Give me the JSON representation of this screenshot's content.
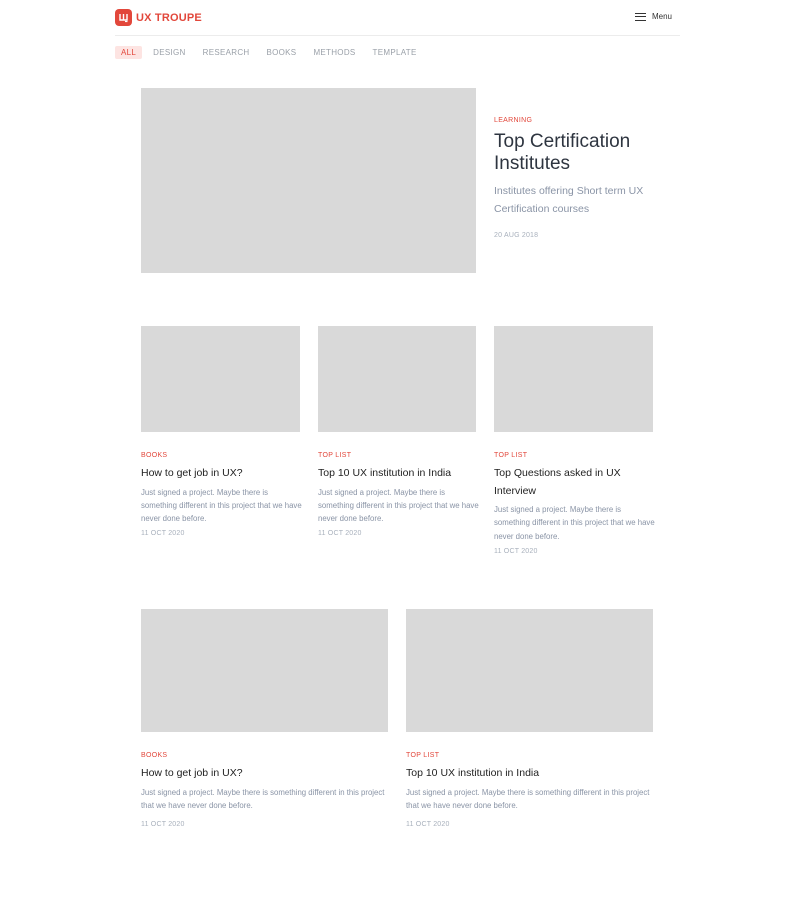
{
  "brand": {
    "name": "UX TROUPE",
    "color": "#e2473b"
  },
  "header": {
    "menu_label": "Menu",
    "menu_icon": "hamburger-icon"
  },
  "filters": [
    {
      "label": "ALL",
      "active": true
    },
    {
      "label": "DESIGN",
      "active": false
    },
    {
      "label": "RESEARCH",
      "active": false
    },
    {
      "label": "BOOKS",
      "active": false
    },
    {
      "label": "METHODS",
      "active": false
    },
    {
      "label": "TEMPLATE",
      "active": false
    }
  ],
  "featured": {
    "category": "LEARNING",
    "title": "Top Certification Institutes",
    "subtitle": "Institutes offering Short term UX Certification courses",
    "date": "20 AUG 2018"
  },
  "row1": [
    {
      "category": "BOOKS",
      "title": "How to get job in UX?",
      "description": "Just signed a project. Maybe there is something different in this project that we have never done before.",
      "date": "11 OCT 2020"
    },
    {
      "category": "TOP LIST",
      "title": "Top 10 UX institution in  India",
      "description": "Just signed a project. Maybe there is something different in this project that we have never done before.",
      "date": "11 OCT 2020"
    },
    {
      "category": "TOP LIST",
      "title": "Top Questions asked in UX Interview",
      "description": "Just signed a project. Maybe there is something different in this project that we have never done before.",
      "date": "11 OCT 2020"
    }
  ],
  "row2": [
    {
      "category": "BOOKS",
      "title": "How to get job in UX?",
      "description": "Just signed a project. Maybe there is something different in this project that we have never done before.",
      "date": "11 OCT 2020"
    },
    {
      "category": "TOP LIST",
      "title": "Top 10 UX institution in  India",
      "description": "Just signed a project. Maybe there is something different in this project that we have never done before.",
      "date": "11 OCT 2020"
    }
  ]
}
